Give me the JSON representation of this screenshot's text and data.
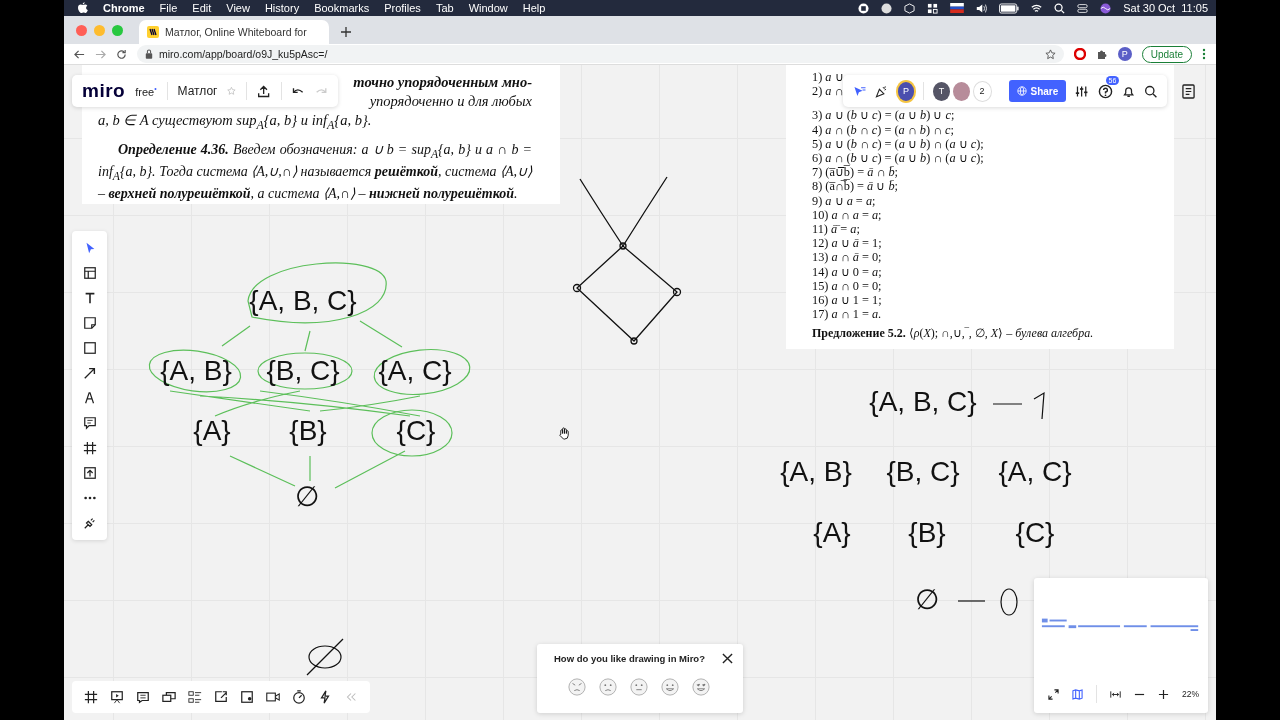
{
  "menubar": {
    "app": "Chrome",
    "items": [
      "File",
      "Edit",
      "View",
      "History",
      "Bookmarks",
      "Profiles",
      "Tab",
      "Window",
      "Help"
    ],
    "clock": "Sat 30 Oct  11:05"
  },
  "browser": {
    "tab_title": "Матлог, Online Whiteboard for",
    "url": "miro.com/app/board/o9J_ku5pAsc=/",
    "profile": "P",
    "update_button": "Update"
  },
  "board_bar": {
    "logo": "miro",
    "plan": "free",
    "plan_mark": "•",
    "board_name": "Матлог"
  },
  "collab_bar": {
    "avatar": "P",
    "collaborator": "T",
    "collaborator_count": "2",
    "share_button": "Share",
    "help_badge": "56"
  },
  "left_document": {
    "lines": [
      "точно упорядоченным мно-",
      "упорядоченно и для любых",
      "a, b ∈ A существуют sup$_{A}${a, b} и inf$_{A}${a, b}."
    ],
    "definition": "**Определение 4.36.** Введем обозначения: a ∪ b = sup$_{A}${a, b} и a ∩ b = inf$_{A}${a, b}. Тогда система ⟨A,∪,∩⟩ называется **решёткой**, система ⟨A,∪⟩ – **верхней полурешёткой**, а система ⟨A,∩⟩ – **нижней полурешёткой**."
  },
  "right_document": {
    "partial_lines": [
      "1) *a* ∪",
      "2) *a* ∩"
    ],
    "lines": [
      "3) *a* ∪ (*b* ∪ *c*) = (*a* ∪ *b*) ∪ *c*;",
      "4) *a* ∩ (*b* ∩ *c*) = (*a* ∩ *b*) ∩ *c*;",
      "5) *a* ∪ (*b* ∩ *c*) = (*a* ∪ *b*) ∩ (*a* ∪ *c*);",
      "6) *a* ∩ (*b* ∪ *c*) = (*a* ∪ *b*) ∩ (*a* ∪ *c*);",
      "7) (a̅∪̅b̅) = *ā* ∩ *b̄*;",
      "8) (a̅∩̅b̅) = *ā* ∪ *b̄*;",
      "9) *a* ∪ *a* = *a*;",
      "10) *a* ∩ *a* = *a*;",
      "11) *ā̄* = *a*;",
      "12) *a* ∪ *ā* = 1;",
      "13) *a* ∩ *ā* = 0;",
      "14) *a* ∪ 0 = *a*;",
      "15) *a* ∩ 0 = 0;",
      "16) *a* ∪ 1 = 1;",
      "17) *a* ∩ 1 = *a*."
    ],
    "proposition": "**Предложение 5.2.** ⟨*ρ*(*X*); ∩,∪,‾, ∅, *X*⟩ – *булева алгебра.*"
  },
  "left_diagram": {
    "labels": [
      "{A, B, C}",
      "{A, B}",
      "{B, C}",
      "{A, C}",
      "{A}",
      "{B}",
      "{C}",
      "∅"
    ]
  },
  "right_diagram": {
    "labels": [
      "{A, B, C}",
      "{A, B}",
      "{B, C}",
      "{A, C}",
      "{A}",
      "{B}",
      "{C}",
      "∅"
    ]
  },
  "feedback": {
    "question": "How do you like drawing in Miro?"
  },
  "zoom": {
    "value": "22%"
  }
}
